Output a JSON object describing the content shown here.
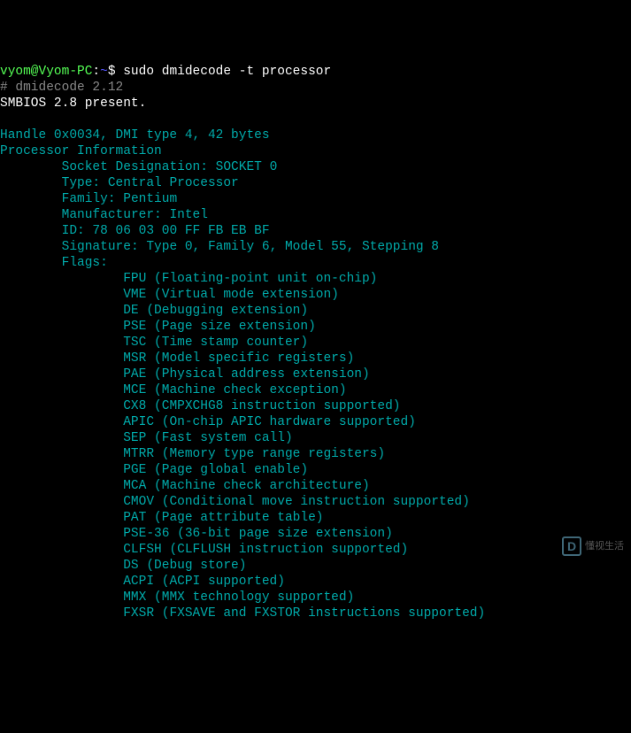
{
  "prompt": {
    "user_host": "vyom@Vyom-PC",
    "separator": ":",
    "path": "~",
    "suffix": "$ ",
    "command": "sudo dmidecode -t processor"
  },
  "header": {
    "comment": "# dmidecode 2.12",
    "smbios": "SMBIOS 2.8 present."
  },
  "handle": "Handle 0x0034, DMI type 4, 42 bytes",
  "section": "Processor Information",
  "fields": {
    "socket": "Socket Designation: SOCKET 0",
    "type": "Type: Central Processor",
    "family": "Family: Pentium",
    "manufacturer": "Manufacturer: Intel",
    "id": "ID: 78 06 03 00 FF FB EB BF",
    "signature": "Signature: Type 0, Family 6, Model 55, Stepping 8",
    "flags_label": "Flags:"
  },
  "flags": [
    "FPU (Floating-point unit on-chip)",
    "VME (Virtual mode extension)",
    "DE (Debugging extension)",
    "PSE (Page size extension)",
    "TSC (Time stamp counter)",
    "MSR (Model specific registers)",
    "PAE (Physical address extension)",
    "MCE (Machine check exception)",
    "CX8 (CMPXCHG8 instruction supported)",
    "APIC (On-chip APIC hardware supported)",
    "SEP (Fast system call)",
    "MTRR (Memory type range registers)",
    "PGE (Page global enable)",
    "MCA (Machine check architecture)",
    "CMOV (Conditional move instruction supported)",
    "PAT (Page attribute table)",
    "PSE-36 (36-bit page size extension)",
    "CLFSH (CLFLUSH instruction supported)",
    "DS (Debug store)",
    "ACPI (ACPI supported)",
    "MMX (MMX technology supported)",
    "FXSR (FXSAVE and FXSTOR instructions supported)"
  ],
  "watermark": {
    "icon": "D",
    "text": "懂视生活"
  }
}
